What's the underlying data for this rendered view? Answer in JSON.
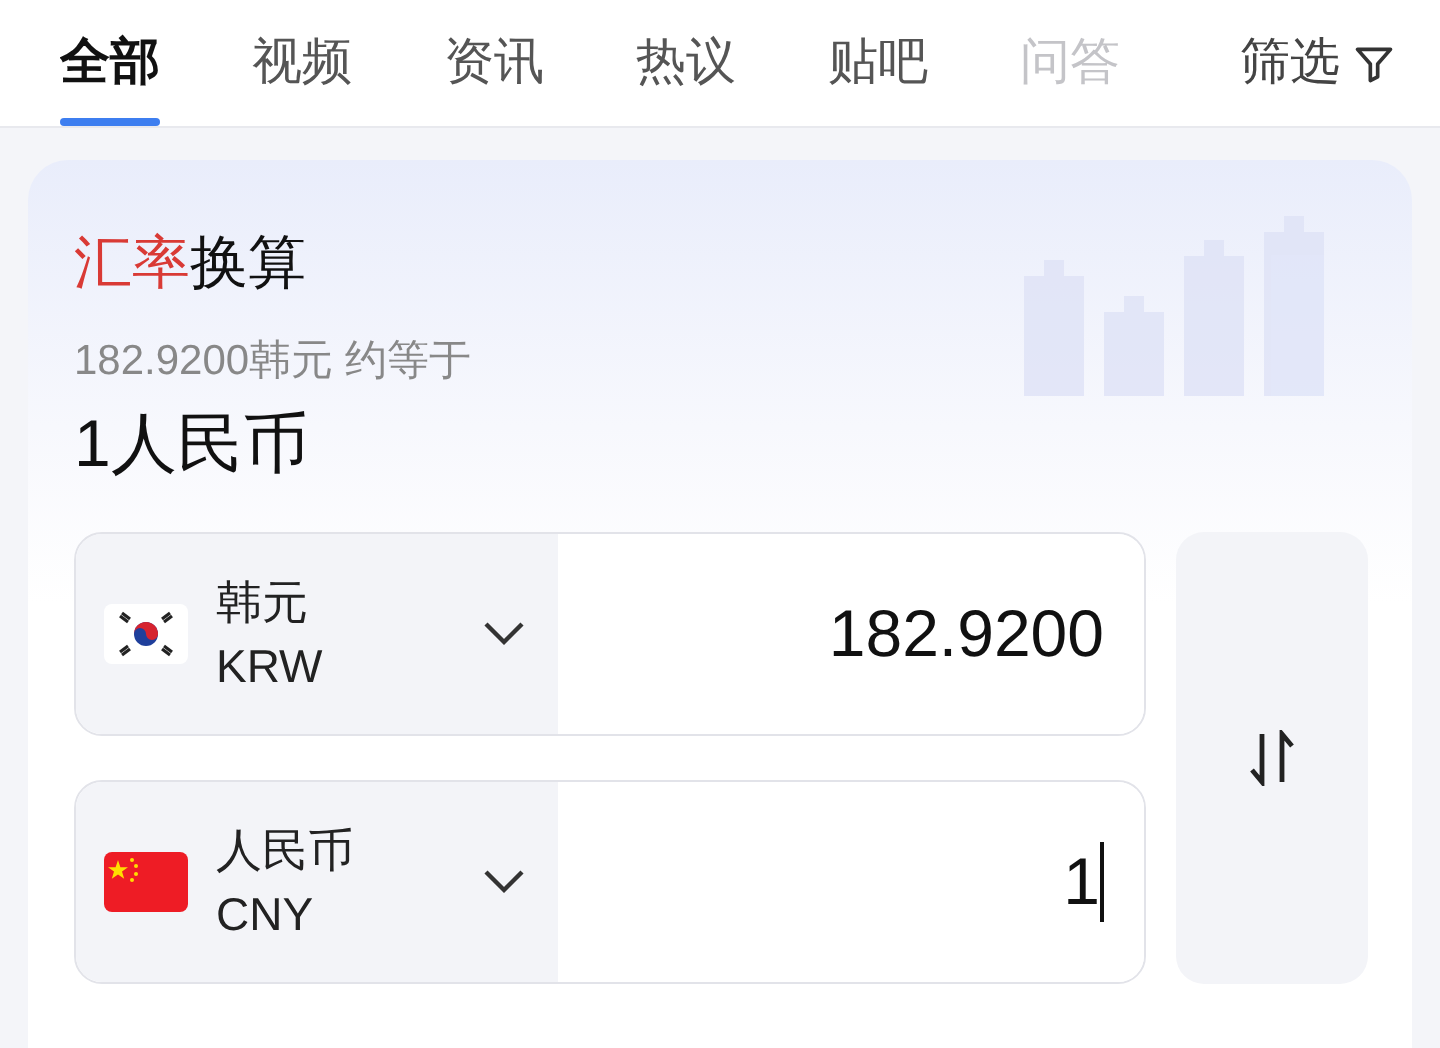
{
  "tabs": [
    {
      "label": "全部",
      "selected": true,
      "faded": false
    },
    {
      "label": "视频",
      "selected": false,
      "faded": false
    },
    {
      "label": "资讯",
      "selected": false,
      "faded": false
    },
    {
      "label": "热议",
      "selected": false,
      "faded": false
    },
    {
      "label": "贴吧",
      "selected": false,
      "faded": false
    },
    {
      "label": "问答",
      "selected": false,
      "faded": true
    }
  ],
  "filter": {
    "label": "筛选"
  },
  "converter": {
    "title": {
      "accent": "汇率",
      "rest": "换算"
    },
    "summary": "182.9200韩元 约等于",
    "result": "1人民币",
    "currencies": [
      {
        "kind": "kr",
        "name": "韩元",
        "code": "KRW",
        "value": "182.9200",
        "focused": false
      },
      {
        "kind": "cn",
        "name": "人民币",
        "code": "CNY",
        "value": "1",
        "focused": true
      }
    ]
  }
}
